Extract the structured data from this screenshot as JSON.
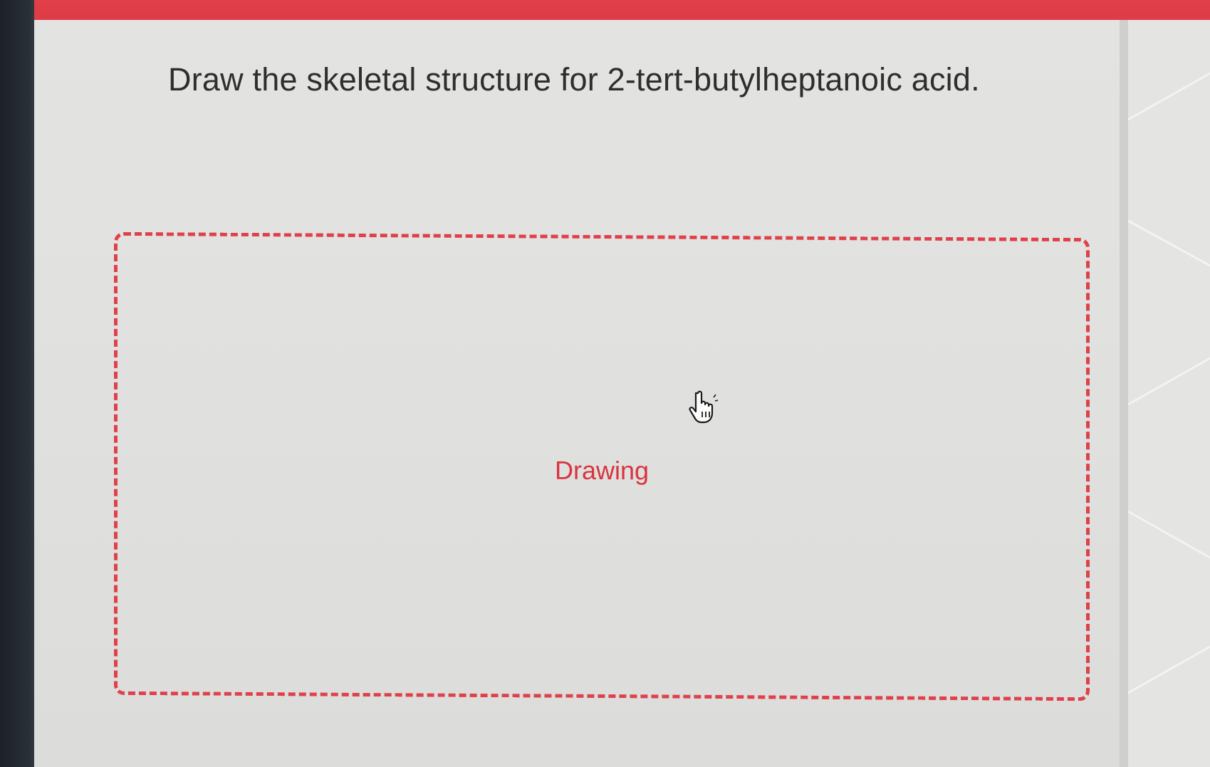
{
  "question": {
    "text": "Draw the skeletal structure for 2-tert-butylheptanoic acid."
  },
  "drawing_area": {
    "label": "Drawing"
  },
  "colors": {
    "accent": "#e0404a",
    "label": "#d9343e",
    "text": "#2e2e2e",
    "background": "#e2e2e0"
  },
  "cursor": {
    "icon": "hand-pointer-icon"
  }
}
